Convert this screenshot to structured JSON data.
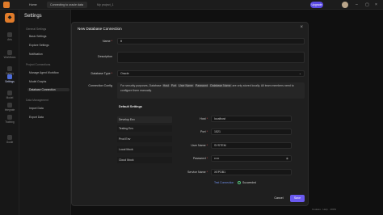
{
  "titlebar": {
    "tabs": [
      {
        "label": "Home"
      },
      {
        "label": "Connecting to oracle data"
      },
      {
        "label": "My project_1"
      }
    ],
    "upgrade_label": "Upgrade"
  },
  "rail": {
    "items": [
      {
        "label": "Arts"
      },
      {
        "label": "Workflows"
      },
      {
        "label": "Gallery"
      },
      {
        "label": "Settings"
      },
      {
        "label": "Model"
      },
      {
        "label": "Integrate"
      },
      {
        "label": "Training"
      },
      {
        "label": "Guide"
      }
    ]
  },
  "sidebar": {
    "title": "Settings",
    "sections": [
      {
        "heading": "General Settings",
        "items": [
          "Basic Settings",
          "Explore Settings",
          "Notification"
        ]
      },
      {
        "heading": "Project Connections",
        "items": [
          "Manage Agent Workflow",
          "Model Graphs",
          "Database Connection"
        ]
      },
      {
        "heading": "Data Management",
        "items": [
          "Import Data",
          "Export Data"
        ]
      }
    ]
  },
  "modal": {
    "title": "New Database Connection",
    "fields": {
      "name": {
        "label": "Name",
        "value": "tt"
      },
      "description": {
        "label": "Description",
        "value": ""
      },
      "db_type": {
        "label": "Database Type",
        "value": "Oracle"
      },
      "conn_config": {
        "label": "Connection Config"
      }
    },
    "info_text": {
      "part1": "For security purposes, Database",
      "tag1": "Host",
      "tag2": "Port",
      "tag3": "User Name",
      "tag4": "Password",
      "tag5": "Database Name",
      "part2": "are only stored locally. All team members need to configure them manually."
    },
    "env_heading": "Default Settings",
    "envs": [
      "Develop Env",
      "Testing Env",
      "Prod Env",
      "Local Mock",
      "Cloud Mock"
    ],
    "conn_fields": {
      "host": {
        "label": "Host",
        "value": "localhost"
      },
      "port": {
        "label": "Port",
        "value": "1521"
      },
      "user": {
        "label": "User Name",
        "value": "SYSTEM"
      },
      "password": {
        "label": "Password",
        "value": "•••••"
      },
      "service": {
        "label": "Service Name",
        "value": "XEPDB1"
      }
    },
    "test_label": "Test Connection",
    "success_label": "Succeeded",
    "cancel_label": "Cancel",
    "save_label": "Save"
  },
  "status_bar": {
    "items": [
      "Cookies",
      "Help",
      "100%"
    ]
  },
  "colors": {
    "accent": "#6a5af0",
    "brand": "#e07b2a",
    "link": "#6f8ee8",
    "success": "#52c27a"
  }
}
